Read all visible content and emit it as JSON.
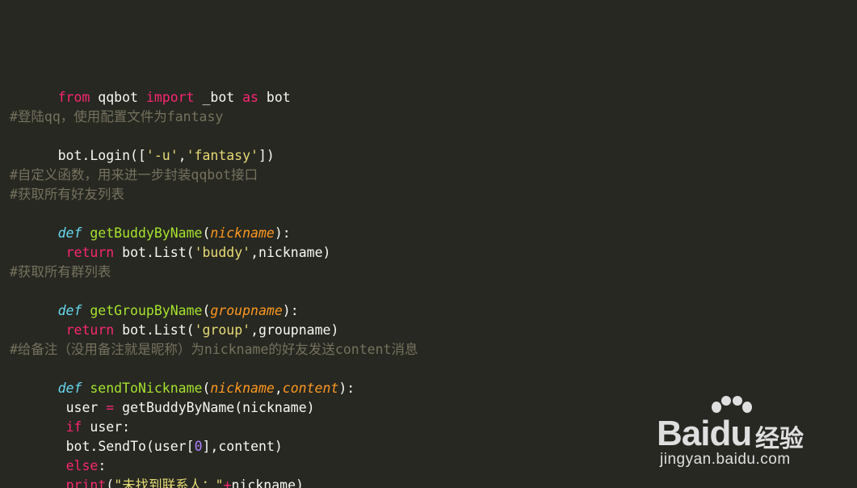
{
  "editor": {
    "theme_background": "#272822",
    "lines": [
      {
        "type": "blank"
      },
      {
        "type": "code",
        "id": "l1"
      },
      {
        "type": "blank"
      },
      {
        "type": "comment",
        "text": "#登陆qq，使用配置文件为fantasy"
      },
      {
        "type": "code",
        "id": "l4"
      },
      {
        "type": "blank"
      },
      {
        "type": "comment",
        "text": "#自定义函数，用来进一步封装qqbot接口"
      },
      {
        "type": "comment",
        "text": "#获取所有好友列表"
      },
      {
        "type": "code",
        "id": "l8"
      },
      {
        "type": "code",
        "id": "l9"
      },
      {
        "type": "blank"
      },
      {
        "type": "comment",
        "text": "#获取所有群列表"
      },
      {
        "type": "code",
        "id": "l12"
      },
      {
        "type": "code",
        "id": "l13"
      },
      {
        "type": "blank"
      },
      {
        "type": "comment",
        "text": "#给备注（没用备注就是昵称）为nickname的好友发送content消息"
      },
      {
        "type": "code",
        "id": "l16"
      },
      {
        "type": "code",
        "id": "l17"
      },
      {
        "type": "code",
        "id": "l18"
      },
      {
        "type": "code",
        "id": "l19"
      },
      {
        "type": "code",
        "id": "l20"
      },
      {
        "type": "code",
        "id": "l21"
      }
    ],
    "tokens": {
      "l1": [
        "from",
        " qqbot ",
        "import",
        " _bot ",
        "as",
        " bot"
      ],
      "l4": [
        "bot.Login([",
        "'-u'",
        ",",
        "'fantasy'",
        "])"
      ],
      "l8": [
        "def",
        " ",
        "getBuddyByName",
        "(",
        "nickname",
        "):"
      ],
      "l9": [
        "return",
        " bot.List(",
        "'buddy'",
        ",nickname)"
      ],
      "l12": [
        "def",
        " ",
        "getGroupByName",
        "(",
        "groupname",
        "):"
      ],
      "l13": [
        "return",
        " bot.List(",
        "'group'",
        ",groupname)"
      ],
      "l16": [
        "def",
        " ",
        "sendToNickname",
        "(",
        "nickname",
        ",",
        "content",
        "):"
      ],
      "l17": [
        "user ",
        "=",
        " getBuddyByName(nickname)"
      ],
      "l18": [
        "if",
        " user:"
      ],
      "l19": [
        "bot.SendTo(user[",
        "0",
        "],content)"
      ],
      "l20": [
        "else",
        ":"
      ],
      "l21": [
        "print",
        "(",
        "\"未找到联系人：\"",
        "+",
        "nickname)"
      ]
    }
  },
  "watermark": {
    "logo_text_a": "Bai",
    "logo_text_b": "du",
    "logo_cn": "经验",
    "url": "jingyan.baidu.com"
  },
  "colors": {
    "keyword": "#f92672",
    "def": "#66d9ef",
    "function": "#a6e22e",
    "param": "#fd971f",
    "string": "#e6db74",
    "number": "#ae81ff",
    "comment": "#75715e",
    "text": "#f8f8f2"
  }
}
